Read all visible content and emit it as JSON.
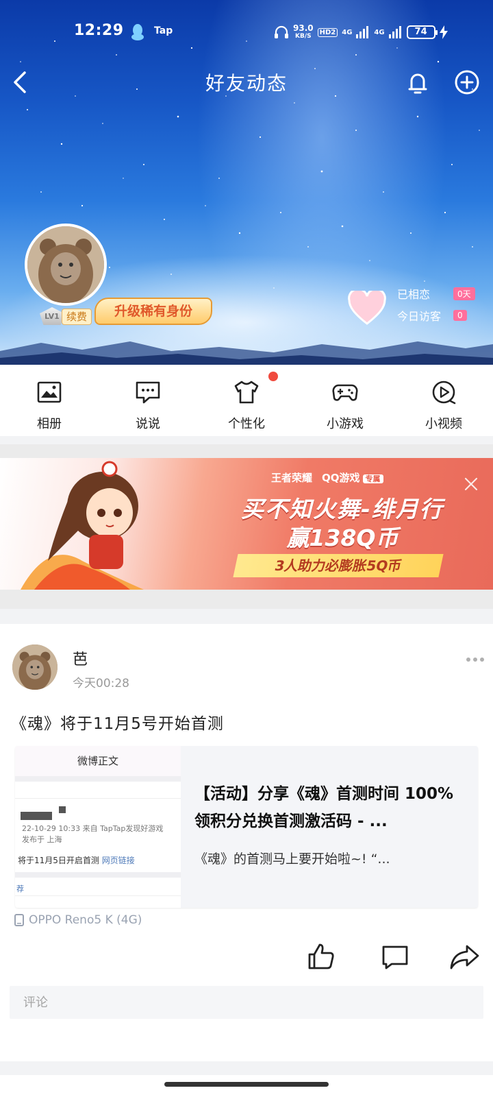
{
  "status_bar": {
    "time": "12:29",
    "app_tag": "Tap",
    "net_speed": "93.0",
    "net_unit": "KB/S",
    "hd": "HD2",
    "signal1": "4G",
    "signal2": "4G",
    "battery": "74"
  },
  "header": {
    "title": "好友动态"
  },
  "profile": {
    "level": "LV1",
    "renew": "续费",
    "upgrade": "升级稀有身份",
    "stats": [
      {
        "label": "已相恋",
        "value": "0天"
      },
      {
        "label": "今日访客",
        "value": "0"
      }
    ]
  },
  "functions": [
    {
      "label": "相册",
      "icon": "photo-album-icon"
    },
    {
      "label": "说说",
      "icon": "chat-bubble-icon"
    },
    {
      "label": "个性化",
      "icon": "tshirt-icon",
      "badge": true
    },
    {
      "label": "小游戏",
      "icon": "gamepad-icon"
    },
    {
      "label": "小视频",
      "icon": "play-video-icon"
    }
  ],
  "banner": {
    "logo1": "王者荣耀",
    "logo2": "QQ游戏",
    "logo2_tag": "专属",
    "headline1": "买不知火舞-绯月行",
    "headline2": "赢138Q币",
    "subline": "3人助力必膨胀5Q币"
  },
  "post": {
    "author": "芭",
    "time": "今天00:28",
    "text": "《魂》将于11月5号开始首测",
    "card": {
      "thumb_header": "微博正文",
      "thumb_meta1": "22-10-29 10:33  来自 TapTap发现好游戏",
      "thumb_meta2": "发布于 上海",
      "thumb_body": "将于11月5日开启首测",
      "thumb_link": "网页链接",
      "thumb_tag": "荐",
      "title": "【活动】分享《魂》首测时间 100%领积分兑换首测激活码 - ...",
      "desc": "《魂》的首测马上要开始啦~!  “..."
    },
    "device": "OPPO Reno5 K (4G)",
    "comment_placeholder": "评论"
  },
  "colors": {
    "accent_pink": "#ff6f9c",
    "red_dot": "#f04a3e",
    "link_blue": "#4d79b8"
  }
}
